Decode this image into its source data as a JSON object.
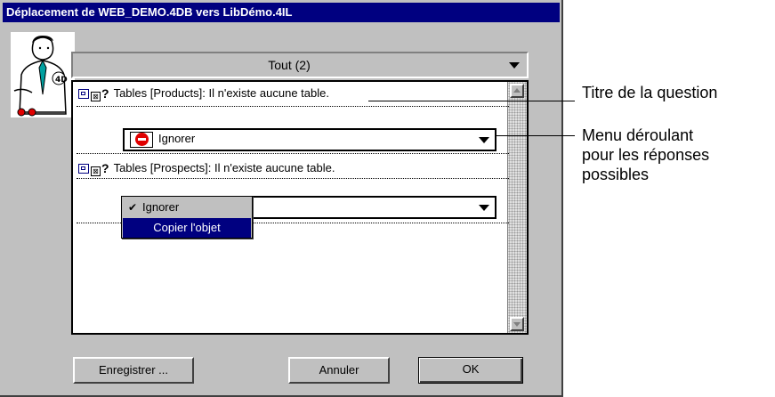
{
  "window": {
    "title": "Déplacement de WEB_DEMO.4DB vers LibDémo.4IL"
  },
  "filter": {
    "selected": "Tout (2)"
  },
  "questions": [
    {
      "text": "Tables [Products]: Il n'existe aucune table.",
      "answer": "Ignorer"
    },
    {
      "text": "Tables [Prospects]: Il n'existe aucune table.",
      "answer": ""
    }
  ],
  "menu": {
    "options": [
      "Ignorer",
      "Copier l'objet"
    ],
    "checked": "Ignorer",
    "highlighted": "Copier l'objet"
  },
  "buttons": {
    "save": "Enregistrer ...",
    "cancel": "Annuler",
    "ok": "OK"
  },
  "callouts": {
    "question_title": "Titre de la question",
    "dropdown": "Menu déroulant\npour les réponses\npossibles"
  },
  "icons": {
    "avatar": "user-with-glasses-icon",
    "question": "object-question-icon",
    "stop": "stop-icon",
    "check": "checkmark-icon"
  },
  "colors": {
    "titlebar": "#000080",
    "stop": "#e00000",
    "face": "#c0c0c0"
  }
}
